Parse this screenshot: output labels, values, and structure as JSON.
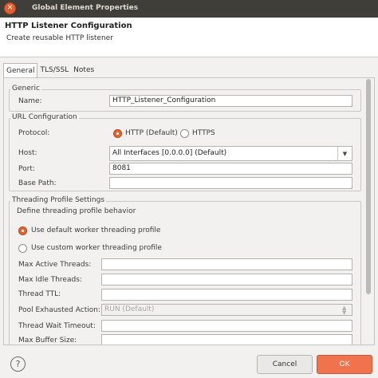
{
  "window": {
    "title": "Global Element Properties",
    "close_glyph": "✕"
  },
  "header": {
    "title": "HTTP Listener Configuration",
    "subtitle": "Create reusable HTTP listener"
  },
  "tabs": [
    {
      "label": "General",
      "active": true
    },
    {
      "label": "TLS/SSL",
      "active": false
    },
    {
      "label": "Notes",
      "active": false
    }
  ],
  "generic": {
    "legend": "Generic",
    "name_label": "Name:",
    "name_value": "HTTP_Listener_Configuration"
  },
  "url_config": {
    "legend": "URL Configuration",
    "protocol_label": "Protocol:",
    "protocol_options": [
      "HTTP (Default)",
      "HTTPS"
    ],
    "protocol_selected": "HTTP (Default)",
    "host_label": "Host:",
    "host_value": "All Interfaces [0.0.0.0] (Default)",
    "port_label": "Port:",
    "port_value": "8081",
    "base_path_label": "Base Path:",
    "base_path_value": ""
  },
  "threading": {
    "legend": "Threading Profile Settings",
    "description": "Define threading profile behavior",
    "options": [
      "Use default worker threading profile",
      "Use custom worker threading profile"
    ],
    "selected": "Use default worker threading profile",
    "max_active_label": "Max Active Threads:",
    "max_idle_label": "Max Idle Threads:",
    "thread_ttl_label": "Thread TTL:",
    "pool_exhausted_label": "Pool Exhausted Action:",
    "pool_exhausted_value": "RUN (Default)",
    "thread_wait_label": "Thread Wait Timeout:",
    "max_buffer_label": "Max Buffer Size:"
  },
  "footer": {
    "help_glyph": "?",
    "cancel_label": "Cancel",
    "ok_label": "OK"
  },
  "colors": {
    "accent": "#f0734e",
    "titlebar": "#3f3e39"
  }
}
